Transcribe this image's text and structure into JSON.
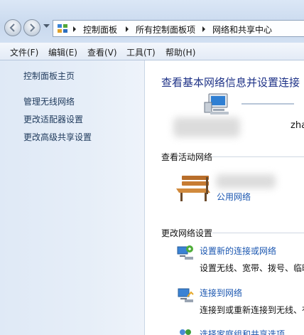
{
  "window": {
    "breadcrumb": [
      "控制面板",
      "所有控制面板项",
      "网络和共享中心"
    ]
  },
  "menubar": {
    "items": [
      "文件(F)",
      "编辑(E)",
      "查看(V)",
      "工具(T)",
      "帮助(H)"
    ]
  },
  "sidebar": {
    "home": "控制面板主页",
    "links": [
      "管理无线网络",
      "更改适配器设置",
      "更改高级共享设置"
    ]
  },
  "main": {
    "title": "查看基本网络信息并设置连接",
    "computer_name": "zha",
    "active_section": "查看活动网络",
    "network_type": "公用网络",
    "change_section": "更改网络设置",
    "tasks": [
      {
        "title": "设置新的连接或网络",
        "description": "设置无线、宽带、拨号、临时"
      },
      {
        "title": "连接到网络",
        "description": "连接到或重新连接到无线、有"
      },
      {
        "title": "选择家庭组和共享选项",
        "description": ""
      }
    ]
  },
  "icons": {
    "back": "back-arrow-icon",
    "forward": "forward-arrow-icon",
    "address": "control-panel-icon",
    "computer": "computer-icon",
    "network": "park-bench-icon",
    "new_connection": "network-setup-icon",
    "connect": "network-connect-icon"
  },
  "colors": {
    "accent": "#1a56b0",
    "title": "#1e3287"
  }
}
